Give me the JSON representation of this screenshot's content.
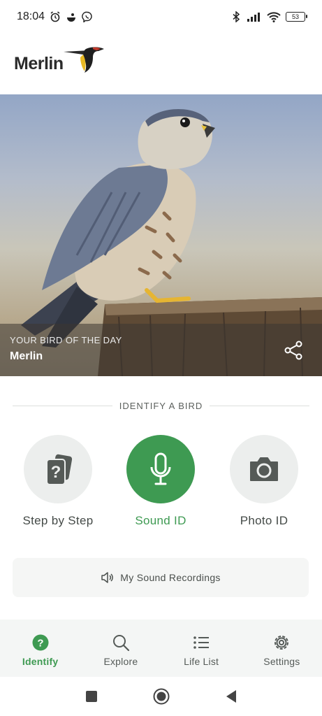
{
  "status_bar": {
    "time": "18:04",
    "battery": "53",
    "left_icons": [
      "alarm-icon",
      "notification-app-icon",
      "viber-icon"
    ],
    "right_icons": [
      "bluetooth-icon",
      "signal-icon",
      "wifi-icon",
      "battery-icon"
    ]
  },
  "header": {
    "logo_text": "Merlin",
    "logo_mark_icon": "merlin-bird-logo"
  },
  "hero": {
    "kicker": "YOUR BIRD OF THE DAY",
    "bird_name": "Merlin",
    "share_icon": "share-icon"
  },
  "identify": {
    "section_label": "IDENTIFY A BIRD",
    "options": [
      {
        "label": "Step by Step",
        "icon": "step-by-step-icon",
        "active": false
      },
      {
        "label": "Sound ID",
        "icon": "microphone-icon",
        "active": true
      },
      {
        "label": "Photo ID",
        "icon": "camera-icon",
        "active": false
      }
    ],
    "recordings_label": "My Sound Recordings",
    "recordings_icon": "speaker-icon"
  },
  "bottom_nav": {
    "items": [
      {
        "label": "Identify",
        "icon": "question-circle-icon",
        "active": true
      },
      {
        "label": "Explore",
        "icon": "search-icon",
        "active": false
      },
      {
        "label": "Life List",
        "icon": "list-icon",
        "active": false
      },
      {
        "label": "Settings",
        "icon": "gear-icon",
        "active": false
      }
    ]
  },
  "system_nav": {
    "buttons": [
      "recents-icon",
      "home-icon",
      "back-icon"
    ]
  },
  "colors": {
    "accent_green": "#3e9a52",
    "circle_bg": "#eceeed",
    "nav_bg": "#f4f6f5"
  }
}
